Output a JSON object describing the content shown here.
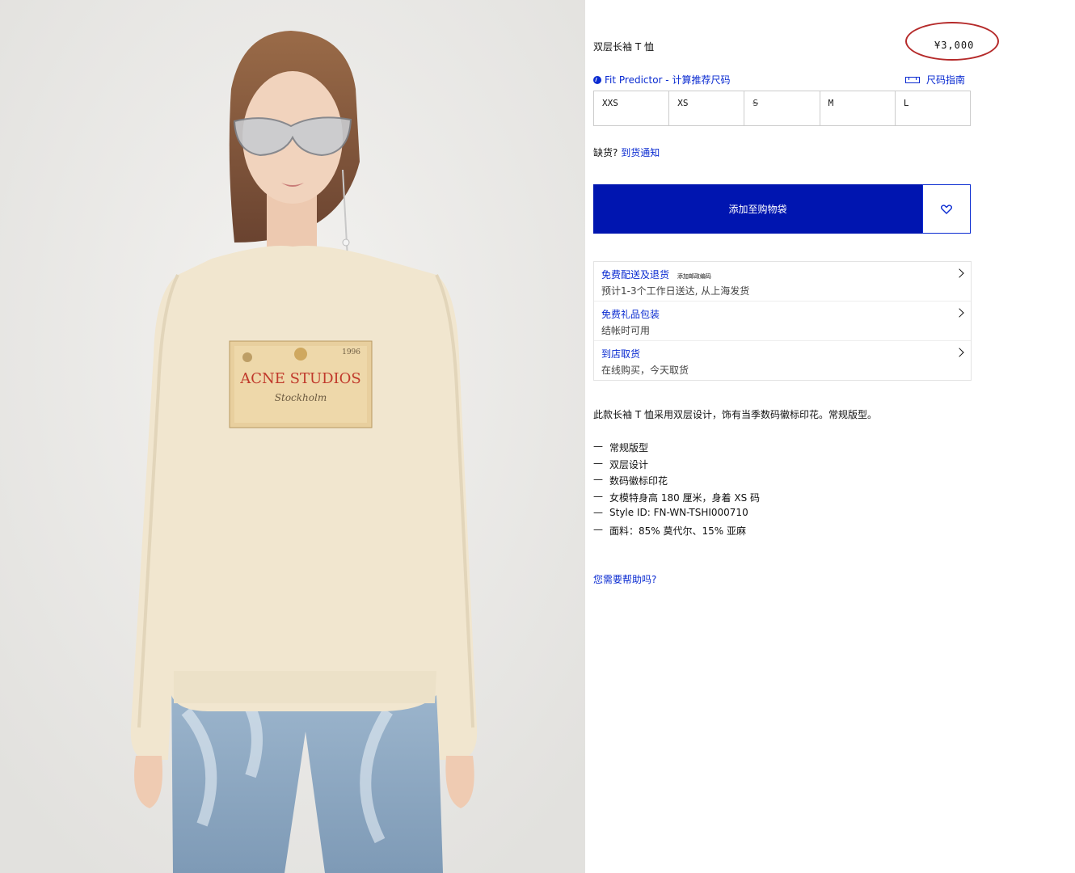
{
  "product": {
    "title": "双层长袖 T 恤",
    "price": "¥3,000"
  },
  "fit": {
    "predictor_label": "Fit Predictor - 计算推荐尺码",
    "size_guide_label": "尺码指南"
  },
  "sizes": [
    {
      "label": "XXS",
      "available": true
    },
    {
      "label": "XS",
      "available": true
    },
    {
      "label": "S",
      "available": false
    },
    {
      "label": "M",
      "available": true
    },
    {
      "label": "L",
      "available": true
    }
  ],
  "stock": {
    "prefix": "缺货?",
    "link": "到货通知"
  },
  "actions": {
    "add_to_bag": "添加至购物袋"
  },
  "info_rows": [
    {
      "title": "免费配送及退货",
      "mini": "添加邮政编码",
      "subtitle": "预计1-3个工作日送达, 从上海发货"
    },
    {
      "title": "免费礼品包装",
      "mini": "",
      "subtitle": "结帐时可用"
    },
    {
      "title": "到店取货",
      "mini": "",
      "subtitle": "在线购买，今天取货"
    }
  ],
  "description": "此款长袖 T 恤采用双层设计，饰有当季数码徽标印花。常规版型。",
  "details": [
    "常规版型",
    "双层设计",
    "数码徽标印花",
    "女模特身高 180 厘米，身着 XS 码",
    "Style ID: FN-WN-TSHI000710",
    "面料：85% 莫代尔、15% 亚麻"
  ],
  "help_link": "您需要帮助吗?",
  "image": {
    "alt": "product photo",
    "print": {
      "brand": "ACNE STUDIOS",
      "year": "1996",
      "city": "Stockholm"
    }
  },
  "colors": {
    "accent_blue": "#0a2bd1",
    "button_blue": "#0015b0",
    "annotation_red": "#b52a2a"
  }
}
